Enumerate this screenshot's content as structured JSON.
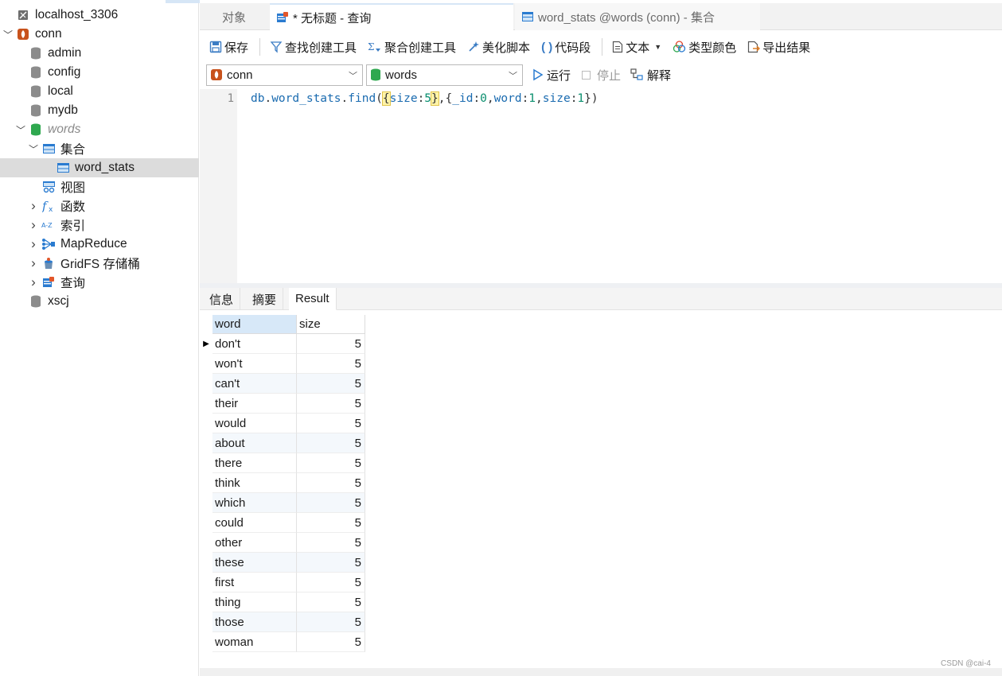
{
  "sidebar": {
    "items": [
      {
        "label": "localhost_3306",
        "icon": "server-icon",
        "chev": "",
        "level": 0
      },
      {
        "label": "conn",
        "icon": "mongodb-leaf-icon",
        "chev": "down",
        "level": 0
      },
      {
        "label": "admin",
        "icon": "database-icon",
        "chev": "",
        "level": 1
      },
      {
        "label": "config",
        "icon": "database-icon",
        "chev": "",
        "level": 1
      },
      {
        "label": "local",
        "icon": "database-icon",
        "chev": "",
        "level": 1
      },
      {
        "label": "mydb",
        "icon": "database-icon",
        "chev": "",
        "level": 1
      },
      {
        "label": "words",
        "icon": "database-green-icon",
        "chev": "down",
        "level": 1
      },
      {
        "label": "集合",
        "icon": "collection-folder-icon",
        "chev": "down",
        "level": 2
      },
      {
        "label": "word_stats",
        "icon": "collection-icon",
        "chev": "",
        "level": 3
      },
      {
        "label": "视图",
        "icon": "view-icon",
        "chev": "",
        "level": 2
      },
      {
        "label": "函数",
        "icon": "function-icon",
        "chev": "right",
        "level": 2
      },
      {
        "label": "索引",
        "icon": "index-icon",
        "chev": "right",
        "level": 2
      },
      {
        "label": "MapReduce",
        "icon": "mapreduce-icon",
        "chev": "right",
        "level": 2
      },
      {
        "label": "GridFS 存储桶",
        "icon": "gridfs-icon",
        "chev": "right",
        "level": 2
      },
      {
        "label": "查询",
        "icon": "query-icon",
        "chev": "right",
        "level": 2
      },
      {
        "label": "xscj",
        "icon": "database-icon",
        "chev": "",
        "level": 1
      }
    ]
  },
  "tabs": [
    {
      "label": "对象"
    },
    {
      "label": "* 无标题 - 查询"
    },
    {
      "label": "word_stats @words (conn) - 集合"
    }
  ],
  "toolbar": {
    "save": "保存",
    "find_builder": "查找创建工具",
    "aggregate_builder": "聚合创建工具",
    "beautify": "美化脚本",
    "snippet": "代码段",
    "text": "文本",
    "type_color": "类型颜色",
    "export": "导出结果"
  },
  "selectors": {
    "connection": "conn",
    "database": "words",
    "run": "运行",
    "stop": "停止",
    "explain": "解释"
  },
  "editor": {
    "line_number": "1",
    "tokens": {
      "db": "db",
      "dot1": ".",
      "collection": "word_stats",
      "dot2": ".",
      "method": "find",
      "open_paren": "(",
      "brace1_open": "{",
      "k_size": "size",
      "colon1": ":",
      "v5": "5",
      "brace1_close": "}",
      "comma1": ",",
      "brace2_open": "{",
      "k_id": "_id",
      "colon2": ":",
      "v0": "0",
      "comma2": ",",
      "k_word": "word",
      "colon3": ":",
      "v1a": "1",
      "comma3": ",",
      "k_size2": "size",
      "colon4": ":",
      "v1b": "1",
      "brace2_close": "}",
      "close_paren": ")"
    }
  },
  "result_tabs": [
    {
      "label": "信息"
    },
    {
      "label": "摘要"
    },
    {
      "label": "Result"
    }
  ],
  "grid": {
    "columns": [
      "word",
      "size"
    ],
    "rows": [
      {
        "word": "don't",
        "size": "5"
      },
      {
        "word": "won't",
        "size": "5"
      },
      {
        "word": "can't",
        "size": "5"
      },
      {
        "word": "their",
        "size": "5"
      },
      {
        "word": "would",
        "size": "5"
      },
      {
        "word": "about",
        "size": "5"
      },
      {
        "word": "there",
        "size": "5"
      },
      {
        "word": "think",
        "size": "5"
      },
      {
        "word": "which",
        "size": "5"
      },
      {
        "word": "could",
        "size": "5"
      },
      {
        "word": "other",
        "size": "5"
      },
      {
        "word": "these",
        "size": "5"
      },
      {
        "word": "first",
        "size": "5"
      },
      {
        "word": "thing",
        "size": "5"
      },
      {
        "word": "those",
        "size": "5"
      },
      {
        "word": "woman",
        "size": "5"
      }
    ]
  },
  "watermark": "CSDN @cai-4",
  "colors": {
    "accent_blue": "#2a7bd0",
    "selection_gray": "#dcdcdc",
    "header_blue": "#d7e8f8",
    "mongo_orange": "#c8521c",
    "db_green": "#2fa84f"
  }
}
